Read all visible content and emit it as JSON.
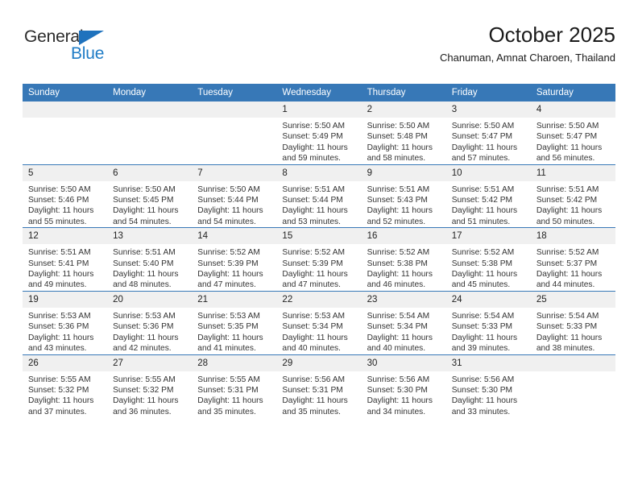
{
  "brand": {
    "name_top": "General",
    "name_bottom": "Blue",
    "triangle_color": "#1f72bd",
    "blue_color": "#1f7cc6"
  },
  "header": {
    "title": "October 2025",
    "location": "Chanuman, Amnat Charoen, Thailand"
  },
  "theme": {
    "header_blue": "#3778b7",
    "date_band_gray": "#f0f0f0",
    "text_color": "#333333"
  },
  "calendar": {
    "weekday_headers": [
      "Sunday",
      "Monday",
      "Tuesday",
      "Wednesday",
      "Thursday",
      "Friday",
      "Saturday"
    ],
    "weeks": [
      [
        {
          "day": "",
          "sunrise": "",
          "sunset": "",
          "daylight": ""
        },
        {
          "day": "",
          "sunrise": "",
          "sunset": "",
          "daylight": ""
        },
        {
          "day": "",
          "sunrise": "",
          "sunset": "",
          "daylight": ""
        },
        {
          "day": "1",
          "sunrise": "Sunrise: 5:50 AM",
          "sunset": "Sunset: 5:49 PM",
          "daylight": "Daylight: 11 hours and 59 minutes."
        },
        {
          "day": "2",
          "sunrise": "Sunrise: 5:50 AM",
          "sunset": "Sunset: 5:48 PM",
          "daylight": "Daylight: 11 hours and 58 minutes."
        },
        {
          "day": "3",
          "sunrise": "Sunrise: 5:50 AM",
          "sunset": "Sunset: 5:47 PM",
          "daylight": "Daylight: 11 hours and 57 minutes."
        },
        {
          "day": "4",
          "sunrise": "Sunrise: 5:50 AM",
          "sunset": "Sunset: 5:47 PM",
          "daylight": "Daylight: 11 hours and 56 minutes."
        }
      ],
      [
        {
          "day": "5",
          "sunrise": "Sunrise: 5:50 AM",
          "sunset": "Sunset: 5:46 PM",
          "daylight": "Daylight: 11 hours and 55 minutes."
        },
        {
          "day": "6",
          "sunrise": "Sunrise: 5:50 AM",
          "sunset": "Sunset: 5:45 PM",
          "daylight": "Daylight: 11 hours and 54 minutes."
        },
        {
          "day": "7",
          "sunrise": "Sunrise: 5:50 AM",
          "sunset": "Sunset: 5:44 PM",
          "daylight": "Daylight: 11 hours and 54 minutes."
        },
        {
          "day": "8",
          "sunrise": "Sunrise: 5:51 AM",
          "sunset": "Sunset: 5:44 PM",
          "daylight": "Daylight: 11 hours and 53 minutes."
        },
        {
          "day": "9",
          "sunrise": "Sunrise: 5:51 AM",
          "sunset": "Sunset: 5:43 PM",
          "daylight": "Daylight: 11 hours and 52 minutes."
        },
        {
          "day": "10",
          "sunrise": "Sunrise: 5:51 AM",
          "sunset": "Sunset: 5:42 PM",
          "daylight": "Daylight: 11 hours and 51 minutes."
        },
        {
          "day": "11",
          "sunrise": "Sunrise: 5:51 AM",
          "sunset": "Sunset: 5:42 PM",
          "daylight": "Daylight: 11 hours and 50 minutes."
        }
      ],
      [
        {
          "day": "12",
          "sunrise": "Sunrise: 5:51 AM",
          "sunset": "Sunset: 5:41 PM",
          "daylight": "Daylight: 11 hours and 49 minutes."
        },
        {
          "day": "13",
          "sunrise": "Sunrise: 5:51 AM",
          "sunset": "Sunset: 5:40 PM",
          "daylight": "Daylight: 11 hours and 48 minutes."
        },
        {
          "day": "14",
          "sunrise": "Sunrise: 5:52 AM",
          "sunset": "Sunset: 5:39 PM",
          "daylight": "Daylight: 11 hours and 47 minutes."
        },
        {
          "day": "15",
          "sunrise": "Sunrise: 5:52 AM",
          "sunset": "Sunset: 5:39 PM",
          "daylight": "Daylight: 11 hours and 47 minutes."
        },
        {
          "day": "16",
          "sunrise": "Sunrise: 5:52 AM",
          "sunset": "Sunset: 5:38 PM",
          "daylight": "Daylight: 11 hours and 46 minutes."
        },
        {
          "day": "17",
          "sunrise": "Sunrise: 5:52 AM",
          "sunset": "Sunset: 5:38 PM",
          "daylight": "Daylight: 11 hours and 45 minutes."
        },
        {
          "day": "18",
          "sunrise": "Sunrise: 5:52 AM",
          "sunset": "Sunset: 5:37 PM",
          "daylight": "Daylight: 11 hours and 44 minutes."
        }
      ],
      [
        {
          "day": "19",
          "sunrise": "Sunrise: 5:53 AM",
          "sunset": "Sunset: 5:36 PM",
          "daylight": "Daylight: 11 hours and 43 minutes."
        },
        {
          "day": "20",
          "sunrise": "Sunrise: 5:53 AM",
          "sunset": "Sunset: 5:36 PM",
          "daylight": "Daylight: 11 hours and 42 minutes."
        },
        {
          "day": "21",
          "sunrise": "Sunrise: 5:53 AM",
          "sunset": "Sunset: 5:35 PM",
          "daylight": "Daylight: 11 hours and 41 minutes."
        },
        {
          "day": "22",
          "sunrise": "Sunrise: 5:53 AM",
          "sunset": "Sunset: 5:34 PM",
          "daylight": "Daylight: 11 hours and 40 minutes."
        },
        {
          "day": "23",
          "sunrise": "Sunrise: 5:54 AM",
          "sunset": "Sunset: 5:34 PM",
          "daylight": "Daylight: 11 hours and 40 minutes."
        },
        {
          "day": "24",
          "sunrise": "Sunrise: 5:54 AM",
          "sunset": "Sunset: 5:33 PM",
          "daylight": "Daylight: 11 hours and 39 minutes."
        },
        {
          "day": "25",
          "sunrise": "Sunrise: 5:54 AM",
          "sunset": "Sunset: 5:33 PM",
          "daylight": "Daylight: 11 hours and 38 minutes."
        }
      ],
      [
        {
          "day": "26",
          "sunrise": "Sunrise: 5:55 AM",
          "sunset": "Sunset: 5:32 PM",
          "daylight": "Daylight: 11 hours and 37 minutes."
        },
        {
          "day": "27",
          "sunrise": "Sunrise: 5:55 AM",
          "sunset": "Sunset: 5:32 PM",
          "daylight": "Daylight: 11 hours and 36 minutes."
        },
        {
          "day": "28",
          "sunrise": "Sunrise: 5:55 AM",
          "sunset": "Sunset: 5:31 PM",
          "daylight": "Daylight: 11 hours and 35 minutes."
        },
        {
          "day": "29",
          "sunrise": "Sunrise: 5:56 AM",
          "sunset": "Sunset: 5:31 PM",
          "daylight": "Daylight: 11 hours and 35 minutes."
        },
        {
          "day": "30",
          "sunrise": "Sunrise: 5:56 AM",
          "sunset": "Sunset: 5:30 PM",
          "daylight": "Daylight: 11 hours and 34 minutes."
        },
        {
          "day": "31",
          "sunrise": "Sunrise: 5:56 AM",
          "sunset": "Sunset: 5:30 PM",
          "daylight": "Daylight: 11 hours and 33 minutes."
        },
        {
          "day": "",
          "sunrise": "",
          "sunset": "",
          "daylight": ""
        }
      ]
    ]
  }
}
